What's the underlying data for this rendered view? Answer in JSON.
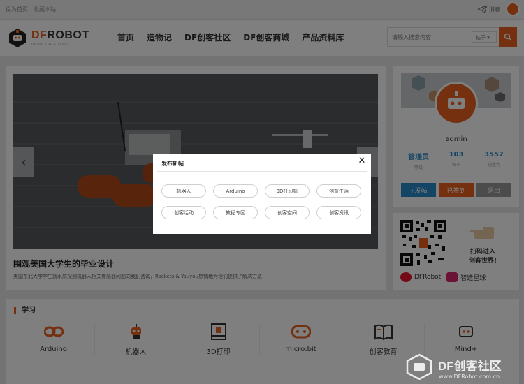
{
  "topbar": {
    "set_home": "设为首页",
    "bookmark": "收藏本站",
    "messages": "消息"
  },
  "header": {
    "brand_df": "DF",
    "brand_robot": "ROBOT",
    "brand_tagline": "DRIVE THE FUTURE",
    "nav": [
      "首页",
      "造物记",
      "DF创客社区",
      "DF创客商城",
      "产品资料库"
    ],
    "search_placeholder": "请输入搜索内容",
    "search_scope": "帖子"
  },
  "slider": {
    "headline": "围观美国大学生的毕业设计",
    "subline": "美国东北大学学生就水质探测机器人相关传感器问题向我们咨询，Rockets & Youyou热情地为他们提供了解决方法"
  },
  "profile": {
    "name": "admin",
    "stats": [
      {
        "value": "管理员",
        "label": "等级"
      },
      {
        "value": "103",
        "label": "帖子"
      },
      {
        "value": "3557",
        "label": "创造力"
      }
    ],
    "buttons": {
      "post": "+发帖",
      "checkin": "已签到",
      "logout": "退出"
    }
  },
  "qr": {
    "scan_text_1": "扫码进入",
    "scan_text_2": "创客世界!",
    "weibo": "DFRobot",
    "zhizao": "智造星球"
  },
  "learn": {
    "title": "学习",
    "categories": [
      "Arduino",
      "机器人",
      "3D打印",
      "micro:bit",
      "创客教育",
      "Mind+"
    ]
  },
  "modal": {
    "title": "发布新帖",
    "close": "✕",
    "tags": [
      "机器人",
      "Arduino",
      "3D打印机",
      "创意生活",
      "创客活动",
      "教程专区",
      "创客空间",
      "创客资讯"
    ]
  },
  "watermark": {
    "big": "DF创客社区",
    "small": "www.DFRobot.com.cn"
  },
  "colors": {
    "accent": "#e8601f",
    "link_blue": "#2a8bc9",
    "post_blue": "#2a8bc9",
    "logout_gray": "#999999"
  }
}
